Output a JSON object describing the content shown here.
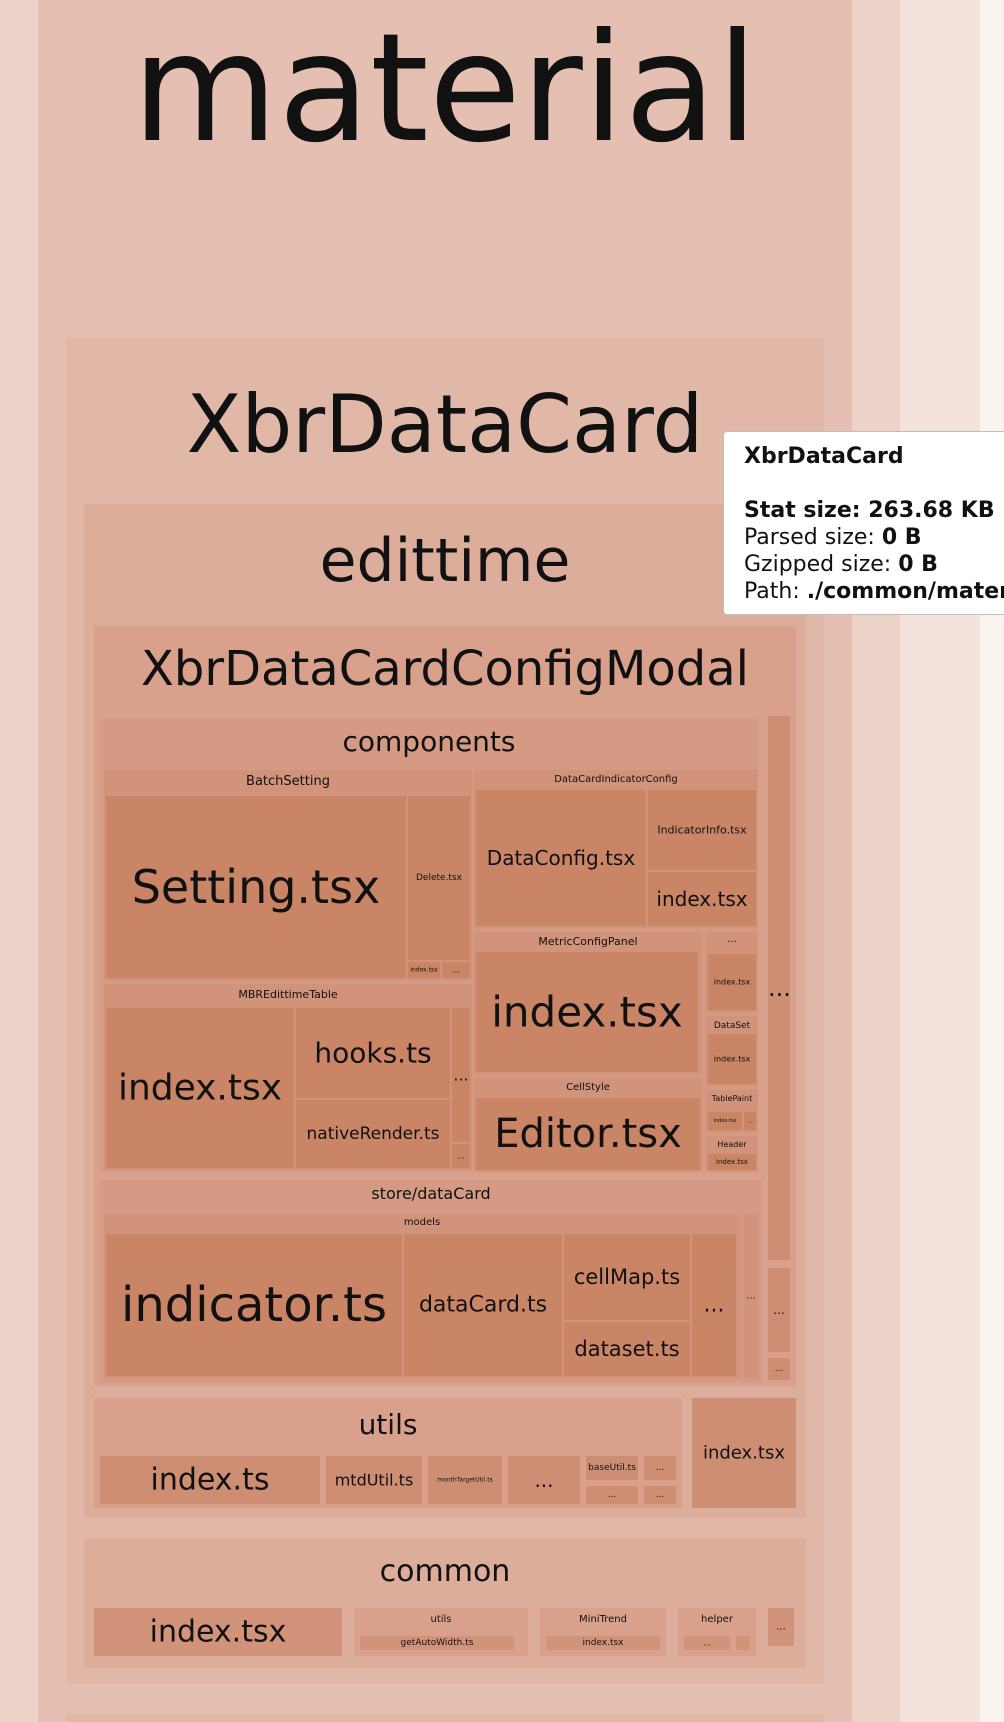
{
  "treemap": {
    "root_label": "material",
    "card_label": "XbrDataCard",
    "edittime_label": "edittime",
    "modal_label": "XbrDataCardConfigModal",
    "components_label": "components",
    "batch_setting": {
      "label": "BatchSetting",
      "setting": "Setting.tsx",
      "delete": "Delete.tsx",
      "index": "index.tsx",
      "more": "..."
    },
    "indicator_config": {
      "label": "DataCardIndicatorConfig",
      "data_config": "DataConfig.tsx",
      "indicator_info": "IndicatorInfo.tsx",
      "index": "index.tsx"
    },
    "metric_panel": {
      "label": "MetricConfigPanel",
      "index": "index.tsx"
    },
    "side_more": "...",
    "side_index": "index.tsx",
    "dataset": {
      "label": "DataSet",
      "index": "index.tsx"
    },
    "table_paint": {
      "label": "TablePaint",
      "index": "index.tsx",
      "more": "..."
    },
    "header": {
      "label": "Header",
      "index": "index.tsx"
    },
    "mbr_table": {
      "label": "MBREdittimeTable",
      "index": "index.tsx",
      "hooks": "hooks.ts",
      "native_render": "nativeRender.ts",
      "more": "...",
      "more_small": "..."
    },
    "cell_style": {
      "label": "CellStyle",
      "editor": "Editor.tsx"
    },
    "store": {
      "label": "store/dataCard",
      "models_label": "models",
      "indicator": "indicator.ts",
      "data_card": "dataCard.ts",
      "cell_map": "cellMap.ts",
      "dataset": "dataset.ts",
      "more": "...",
      "more_small": "..."
    },
    "right_more": "...",
    "right_more2": "...",
    "right_more3": "...",
    "utils": {
      "label": "utils",
      "index": "index.ts",
      "mtd_util": "mtdUtil.ts",
      "month_target_util": "monthTargetUtil.ts",
      "more": "...",
      "base_util": "baseUtil.ts",
      "more_small": "..."
    },
    "edittime_index": "index.tsx",
    "common": {
      "label": "common",
      "index": "index.tsx",
      "utils_label": "utils",
      "get_auto_width": "getAutoWidth.ts",
      "mini_trend_label": "MiniTrend",
      "mini_trend_index": "index.tsx",
      "helper_label": "helper",
      "helper_more": "...",
      "more": "..."
    }
  },
  "tooltip": {
    "title": "XbrDataCard",
    "stat_label": "Stat size:",
    "stat_value": "263.68 KB",
    "parsed_label": "Parsed size:",
    "parsed_value": "0 B",
    "gzip_label": "Gzipped size:",
    "gzip_value": "0 B",
    "path_label": "Path:",
    "path_value": "./common/material/XbrDataCard"
  },
  "colors": {
    "page": "#fbf3ef",
    "root": "#e7c8bd",
    "leaf": "#c98566"
  }
}
